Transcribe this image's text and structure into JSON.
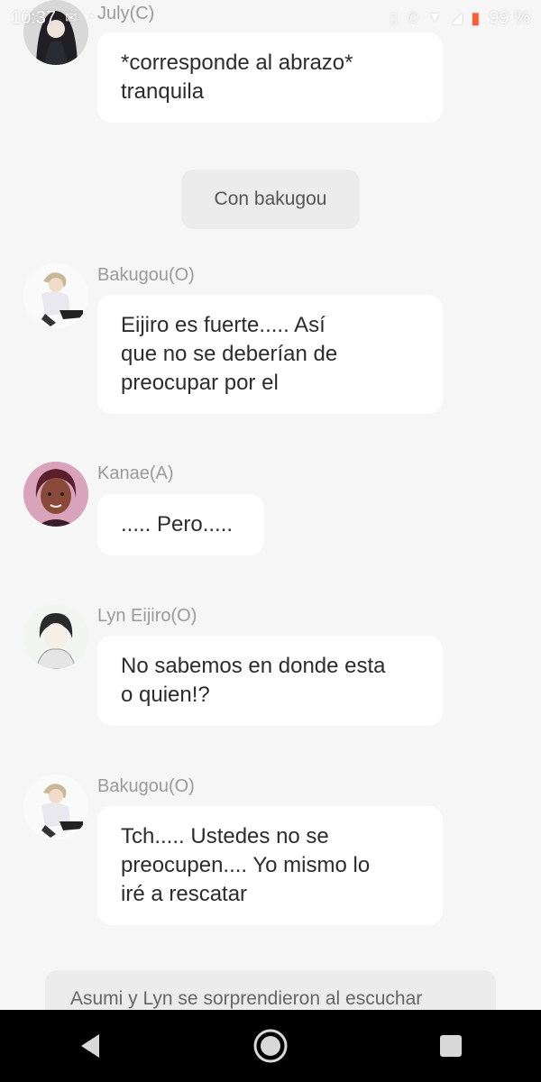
{
  "status_bar": {
    "time": "10:37",
    "battery": "99 %"
  },
  "messages": [
    {
      "sender": "July(C)",
      "text": "*corresponde al abrazo*\ntranquila",
      "avatar": "july-avatar"
    },
    {
      "sender": "Bakugou(O)",
      "text": "Eijiro es fuerte..... Así\nque no se  deberían de\npreocupar por el",
      "avatar": "bakugou-avatar"
    },
    {
      "sender": "Kanae(A)",
      "text": "..... Pero.....",
      "avatar": "kanae-avatar"
    },
    {
      "sender": "Lyn Eijiro(O)",
      "text": "No sabemos en donde esta\no quien!?",
      "avatar": "lyn-avatar"
    },
    {
      "sender": "Bakugou(O)",
      "text": "Tch..... Ustedes no se\npreocupen.... Yo mismo lo\niré a rescatar",
      "avatar": "bakugou-avatar"
    }
  ],
  "system_message": "Con bakugou",
  "narration": "Asumi y Lyn se sorprendieron al escuchar",
  "colors": {
    "background": "#f6f6f6",
    "bubble": "#ffffff",
    "system_bubble": "#ececec",
    "sender_name": "#9a9a9a",
    "battery": "#ff5a36"
  },
  "nav_icons": [
    "back-icon",
    "home-icon",
    "recents-icon"
  ]
}
